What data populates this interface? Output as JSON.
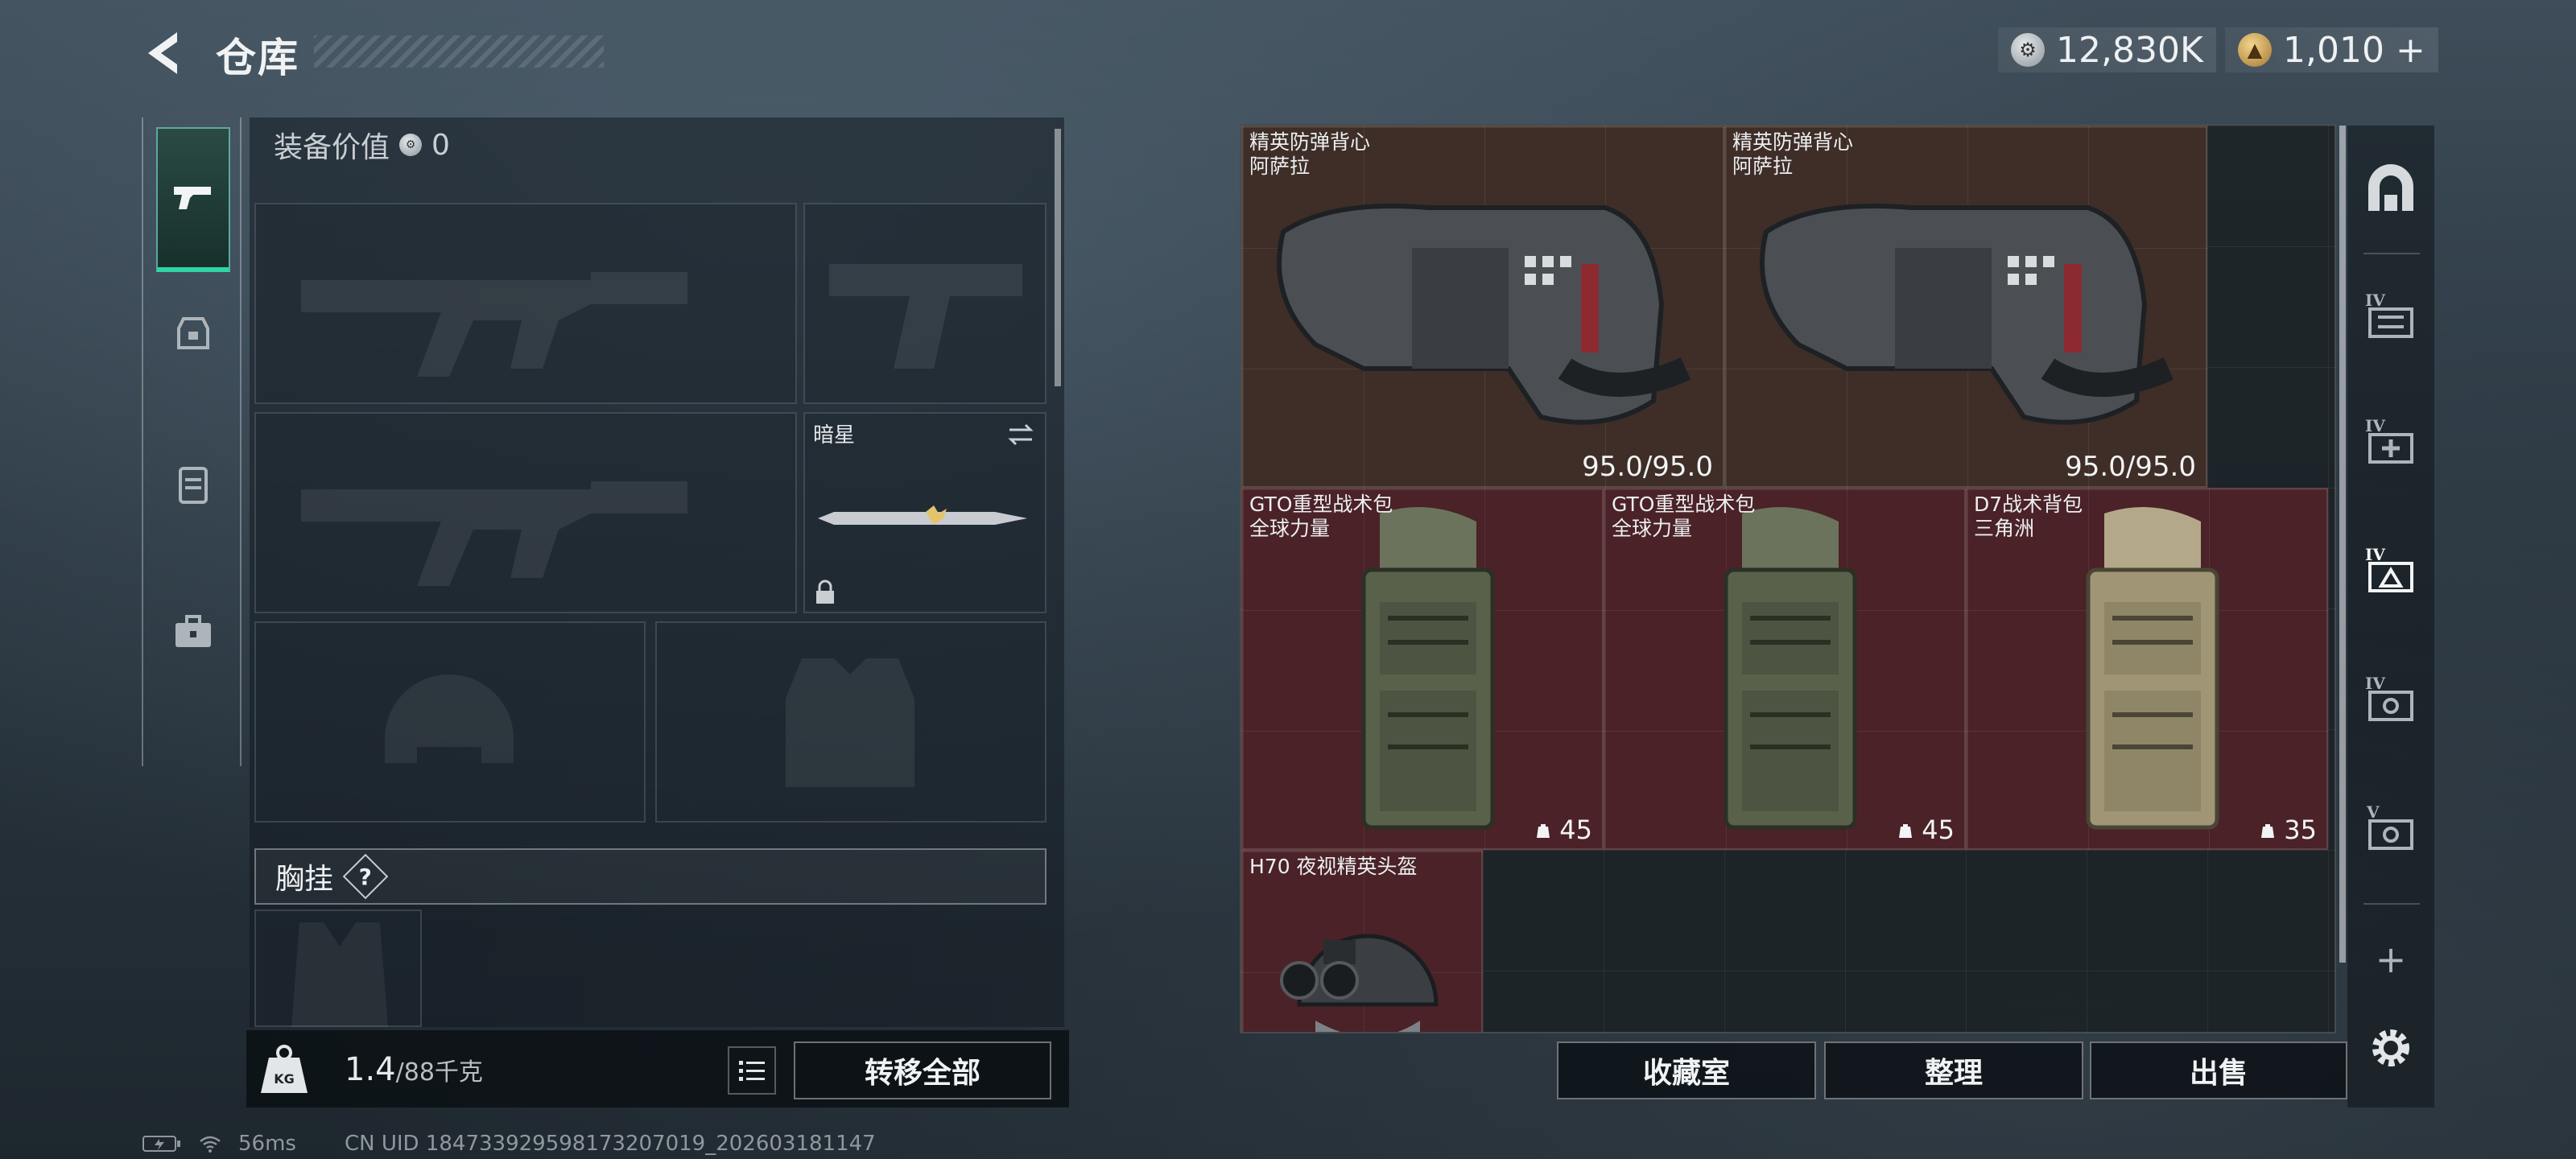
{
  "header": {
    "title": "仓库",
    "currency1": "12,830K",
    "currency2": "1,010",
    "currency2_plus": "+"
  },
  "loadout": {
    "equip_value_label": "装备价值",
    "equip_value": "0",
    "knife_name": "暗星",
    "chest_label": "胸挂",
    "chest_help": "?"
  },
  "weight": {
    "current": "1.4",
    "max": "/88千克"
  },
  "buttons": {
    "transfer_all": "转移全部",
    "collection": "收藏室",
    "organize": "整理",
    "sell": "出售"
  },
  "inventory": {
    "items": [
      {
        "name_line1": "精英防弹背心",
        "name_line2": "阿萨拉",
        "durability": "95.0/95.0"
      },
      {
        "name_line1": "精英防弹背心",
        "name_line2": "阿萨拉",
        "durability": "95.0/95.0"
      },
      {
        "name_line1": "GTO重型战术包",
        "name_line2": "全球力量",
        "capacity": "45"
      },
      {
        "name_line1": "GTO重型战术包",
        "name_line2": "全球力量",
        "capacity": "45"
      },
      {
        "name_line1": "D7战术背包",
        "name_line2": "三角洲",
        "capacity": "35"
      },
      {
        "name_line1": "H70 夜视精英头盔",
        "name_line2": ""
      }
    ]
  },
  "rightnav": {
    "tier_labels": [
      "IV",
      "IV",
      "IV",
      "IV",
      "V"
    ],
    "add_label": "+"
  },
  "status": {
    "ping": "56ms",
    "uid": "CN UID 184733929598173207019_202603181147"
  },
  "colors": {
    "accent": "#2fd4a7",
    "item_brown": "#3e2e27",
    "item_red": "#4a2227"
  }
}
